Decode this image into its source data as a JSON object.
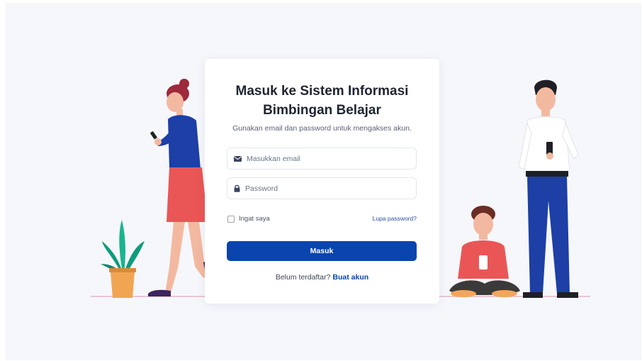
{
  "login": {
    "title": "Masuk ke Sistem Informasi Bimbingan Belajar",
    "subtitle": "Gunakan email dan password untuk mengakses akun.",
    "email": {
      "placeholder": "Masukkan email",
      "icon": "envelope-icon"
    },
    "password": {
      "placeholder": "Password",
      "icon": "lock-icon"
    },
    "remember_label": "Ingat saya",
    "remember_checked": false,
    "forgot_label": "Lupa password?",
    "submit_label": "Masuk",
    "signup_prompt": "Belum terdaftar?",
    "signup_link": "Buat akun"
  },
  "colors": {
    "primary": "#0a45ad",
    "background": "#f6f7fb",
    "card": "#ffffff"
  }
}
